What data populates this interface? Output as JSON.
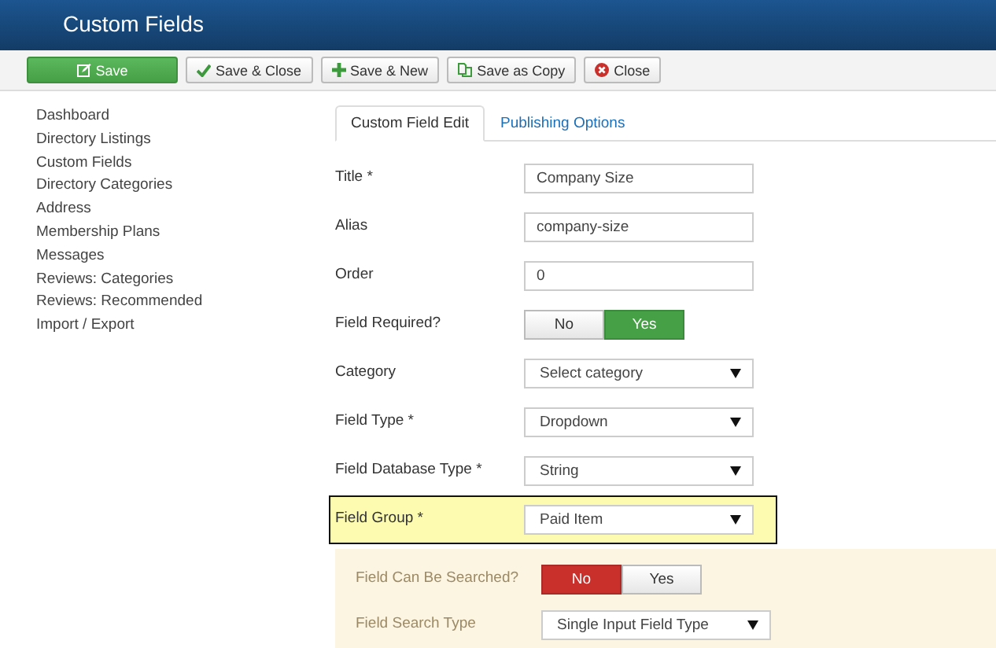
{
  "header": {
    "title": "Custom Fields"
  },
  "toolbar": [
    {
      "kind": "save",
      "label": "Save"
    },
    {
      "kind": "save-close",
      "label": "Save & Close"
    },
    {
      "kind": "save-new",
      "label": "Save & New"
    },
    {
      "kind": "save-copy",
      "label": "Save as Copy"
    },
    {
      "kind": "close",
      "label": "Close"
    }
  ],
  "sidebar": {
    "items": [
      "Dashboard",
      "Directory Listings",
      "Custom Fields",
      "Directory Categories",
      "Address",
      "Membership Plans",
      "Messages",
      "Reviews: Categories",
      "Reviews: Recommended",
      "Import / Export"
    ]
  },
  "tabs": [
    {
      "label": "Custom Field Edit",
      "selected": true
    },
    {
      "label": "Publishing Options",
      "selected": false
    }
  ],
  "fields": [
    {
      "kind": "text",
      "label": "Title *",
      "value": "Company Size",
      "highlighted": false
    },
    {
      "kind": "text",
      "label": "Alias",
      "value": "company-size",
      "highlighted": false
    },
    {
      "kind": "text",
      "label": "Order",
      "value": "0",
      "highlighted": false
    },
    {
      "kind": "toggle",
      "label": "Field Required?",
      "highlighted": false,
      "options": [
        {
          "label": "No",
          "kind": "no",
          "selected": false
        },
        {
          "label": "Yes",
          "kind": "yes",
          "selected": true
        }
      ]
    },
    {
      "kind": "select",
      "label": "Category",
      "value": "Select category",
      "highlighted": false
    },
    {
      "kind": "select",
      "label": "Field Type *",
      "value": "Dropdown",
      "highlighted": false
    },
    {
      "kind": "select",
      "label": "Field Database Type *",
      "value": "String",
      "highlighted": false
    },
    {
      "kind": "select",
      "label": "Field Group *",
      "value": "Paid Item",
      "highlighted": true
    }
  ],
  "search_section": {
    "fields": [
      {
        "kind": "toggle",
        "label": "Field Can Be Searched?",
        "options": [
          {
            "label": "No",
            "kind": "no",
            "selected": true
          },
          {
            "label": "Yes",
            "kind": "yes",
            "selected": false
          }
        ]
      },
      {
        "kind": "select",
        "label": "Field Search Type",
        "value": "Single Input Field Type"
      }
    ]
  }
}
